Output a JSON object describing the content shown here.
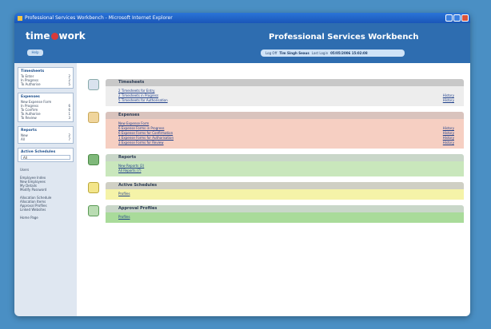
{
  "window": {
    "title": "Professional Services Workbench - Microsoft Internet Explorer"
  },
  "header": {
    "logo_left": "time",
    "logo_right": "work",
    "help_label": "Help",
    "app_title": "Professional Services Workbench",
    "login_label": "Log Off",
    "user_name": "Tim Singh Seaus",
    "last_login_label": "Last Login",
    "last_login_value": "05/05/2006 15:02:08"
  },
  "sidebar": {
    "timesheets": {
      "title": "Timesheets",
      "rows": [
        {
          "label": "To Enter",
          "count": "2"
        },
        {
          "label": "In Progress",
          "count": "2"
        },
        {
          "label": "To Authorise",
          "count": "5"
        }
      ]
    },
    "expenses": {
      "title": "Expenses",
      "rows": [
        {
          "label": "New Expense Form",
          "count": ""
        },
        {
          "label": "In Progress",
          "count": "6"
        },
        {
          "label": "To Confirm",
          "count": "6"
        },
        {
          "label": "To Authorise",
          "count": "1"
        },
        {
          "label": "To Review",
          "count": "3"
        }
      ]
    },
    "reports": {
      "title": "Reports",
      "rows": [
        {
          "label": "New",
          "count": "2"
        },
        {
          "label": "All",
          "count": "7"
        }
      ]
    },
    "schedules": {
      "title": "Active Schedules",
      "select_value": "All"
    },
    "links_a": [
      "Users"
    ],
    "links_b": [
      "Employee Index",
      "New Employees",
      "My Details",
      "Modify Password"
    ],
    "links_c": [
      "Allocation Schedule",
      "Allocation Items",
      "Approval Profiles",
      "Linked Websites"
    ],
    "links_d": [
      "Home Page"
    ]
  },
  "sections": {
    "timesheets": {
      "title": "Timesheets",
      "rows": [
        {
          "link": "2 Timesheets for Entry",
          "history": ""
        },
        {
          "link": "2 Timesheets in Progress",
          "history": "History"
        },
        {
          "link": "5 Timesheets for Authorisation",
          "history": "History"
        }
      ]
    },
    "expenses": {
      "title": "Expenses",
      "rows": [
        {
          "link": "New Expense Form",
          "history": ""
        },
        {
          "link": "6 Expense Forms in Progress",
          "history": "History"
        },
        {
          "link": "6 Expense Forms for Confirmation",
          "history": "History"
        },
        {
          "link": "1 Expense Forms for Authorisation",
          "history": "History"
        },
        {
          "link": "3 Expense Forms for Review",
          "history": "History"
        }
      ]
    },
    "reports": {
      "title": "Reports",
      "rows": [
        {
          "link": "New Reports (2)",
          "history": ""
        },
        {
          "link": "All Reports (7)",
          "history": ""
        }
      ]
    },
    "schedules": {
      "title": "Active Schedules",
      "rows": [
        {
          "link": "Profiles",
          "history": ""
        }
      ]
    },
    "approval": {
      "title": "Approval Profiles",
      "rows": [
        {
          "link": "Profiles",
          "history": ""
        }
      ]
    }
  }
}
